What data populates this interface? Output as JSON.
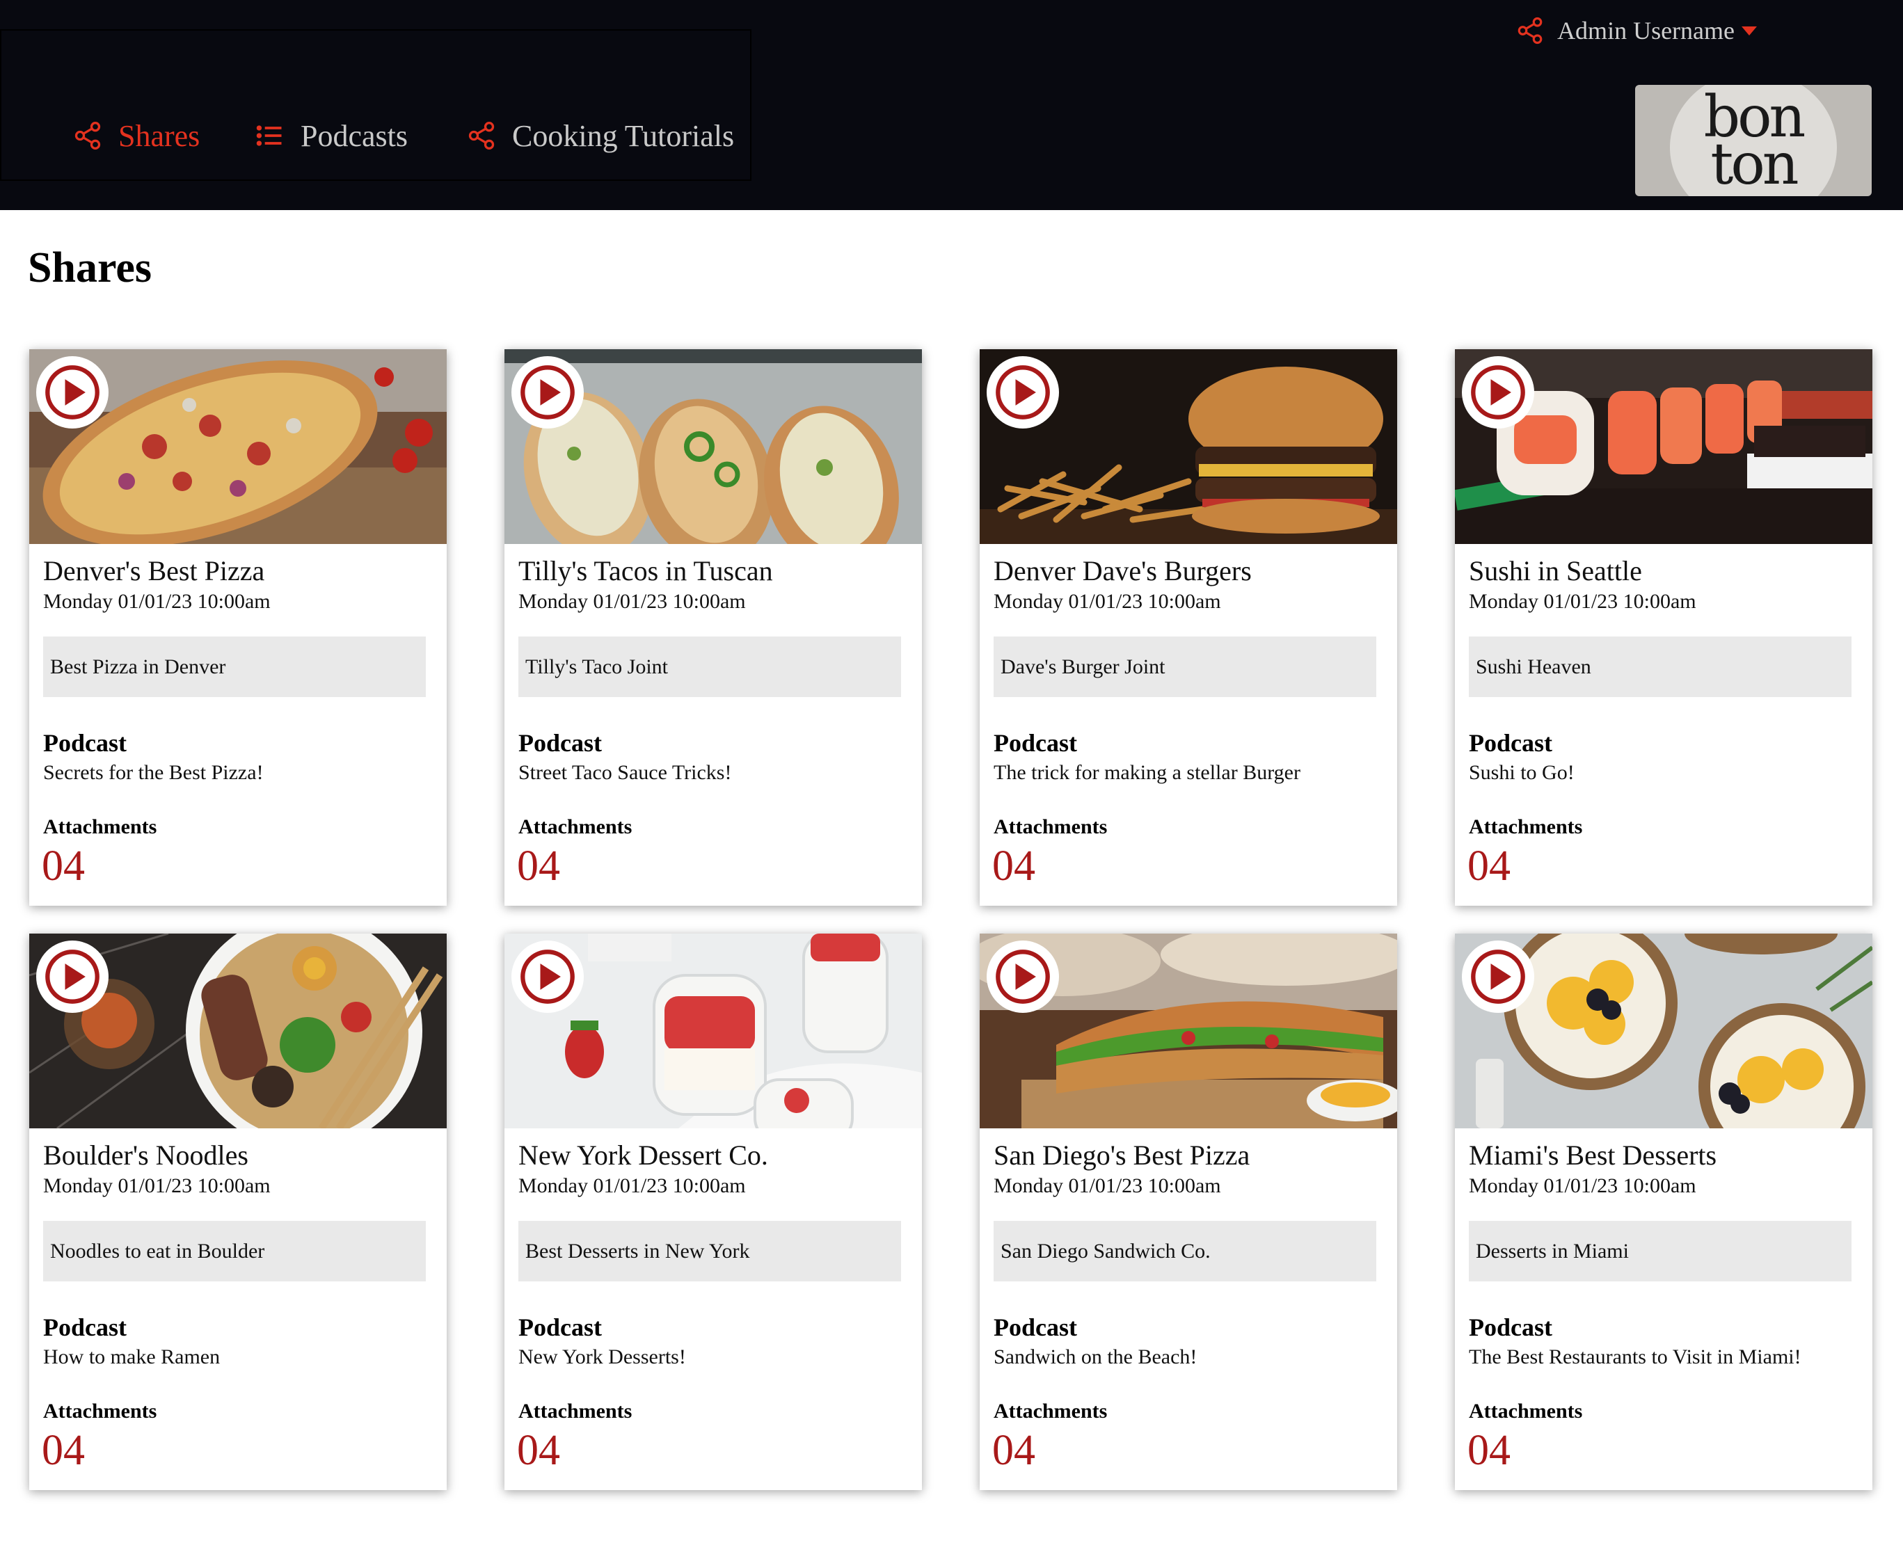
{
  "header": {
    "nav": [
      {
        "label": "Shares",
        "icon": "share-icon",
        "active": true
      },
      {
        "label": "Podcasts",
        "icon": "list-icon",
        "active": false
      },
      {
        "label": "Cooking Tutorials",
        "icon": "share-icon",
        "active": false
      }
    ],
    "user": {
      "label": "Admin Username",
      "icon": "share-icon"
    },
    "logo": {
      "line1": "bon",
      "line2": "ton"
    }
  },
  "page": {
    "title": "Shares"
  },
  "labels": {
    "podcast": "Podcast",
    "attachments": "Attachments"
  },
  "colors": {
    "accent": "#e4321f",
    "count": "#a81919",
    "header_bg": "#080910",
    "place_bg": "#e9e9e9"
  },
  "cards": [
    {
      "title": "Denver's Best Pizza",
      "date": "Monday 01/01/23 10:00am",
      "place": "Best Pizza in Denver",
      "podcast": "Secrets for the Best Pizza!",
      "attachments": "04",
      "image": "pizza"
    },
    {
      "title": "Tilly's Tacos in Tuscan",
      "date": "Monday 01/01/23 10:00am",
      "place": "Tilly's Taco Joint",
      "podcast": "Street Taco Sauce Tricks!",
      "attachments": "04",
      "image": "tacos"
    },
    {
      "title": "Denver Dave's Burgers",
      "date": "Monday 01/01/23 10:00am",
      "place": "Dave's Burger Joint",
      "podcast": "The trick for making a stellar Burger",
      "attachments": "04",
      "image": "burger"
    },
    {
      "title": "Sushi in Seattle",
      "date": "Monday 01/01/23 10:00am",
      "place": "Sushi Heaven",
      "podcast": "Sushi to Go!",
      "attachments": "04",
      "image": "sushi"
    },
    {
      "title": "Boulder's Noodles",
      "date": "Monday 01/01/23 10:00am",
      "place": "Noodles to eat in Boulder",
      "podcast": "How to make Ramen",
      "attachments": "04",
      "image": "ramen"
    },
    {
      "title": "New York Dessert Co.",
      "date": "Monday 01/01/23 10:00am",
      "place": "Best Desserts in New York",
      "podcast": "New York Desserts!",
      "attachments": "04",
      "image": "dessert-jars"
    },
    {
      "title": "San Diego's Best Pizza",
      "date": "Monday 01/01/23 10:00am",
      "place": "San Diego Sandwich Co.",
      "podcast": "Sandwich on the Beach!",
      "attachments": "04",
      "image": "sandwich"
    },
    {
      "title": "Miami's Best Desserts",
      "date": "Monday 01/01/23 10:00am",
      "place": "Desserts in Miami",
      "podcast": "The Best Restaurants to Visit in Miami!",
      "attachments": "04",
      "image": "tarts"
    }
  ]
}
